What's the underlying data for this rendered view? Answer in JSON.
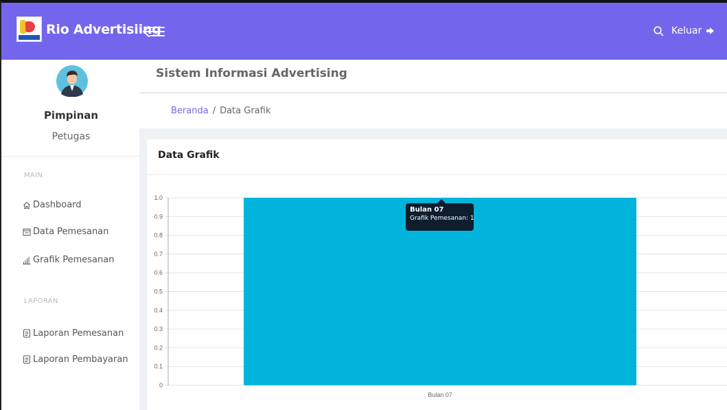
{
  "app": {
    "brand": "Rio Advertisiing",
    "logout_label": "Keluar"
  },
  "user": {
    "name": "Pimpinan",
    "role": "Petugas"
  },
  "sidebar": {
    "sections": [
      {
        "label": "MAIN"
      },
      {
        "label": "LAPORAN"
      }
    ],
    "items": [
      {
        "label": "Dashboard",
        "icon": "home-icon"
      },
      {
        "label": "Data Pemesanan",
        "icon": "table-icon"
      },
      {
        "label": "Grafik Pemesanan",
        "icon": "bar-chart-icon"
      },
      {
        "label": "Laporan Pemesanan",
        "icon": "document-icon"
      },
      {
        "label": "Laporan Pembayaran",
        "icon": "document-icon"
      }
    ]
  },
  "header": {
    "title": "Sistem Informasi Advertising"
  },
  "breadcrumb": {
    "home": "Beranda",
    "separator": "/",
    "current": "Data Grafik"
  },
  "card": {
    "title": "Data Grafik"
  },
  "chart_data": {
    "type": "bar",
    "categories": [
      "Bulan 07"
    ],
    "series": [
      {
        "name": "Grafik Pemesanan",
        "values": [
          1
        ]
      }
    ],
    "ylim": [
      0,
      1
    ],
    "yticks": [
      "0",
      "0.1",
      "0.2",
      "0.3",
      "0.4",
      "0.5",
      "0.6",
      "0.7",
      "0.8",
      "0.9",
      "1.0"
    ],
    "grid": true,
    "color": "#00b4dc"
  },
  "tooltip": {
    "title": "Bulan 07",
    "line": "Grafik Pemesanan: 1"
  },
  "colors": {
    "topbar": "#7366ec",
    "accent": "#7366ec",
    "bar": "#00b4dc"
  }
}
